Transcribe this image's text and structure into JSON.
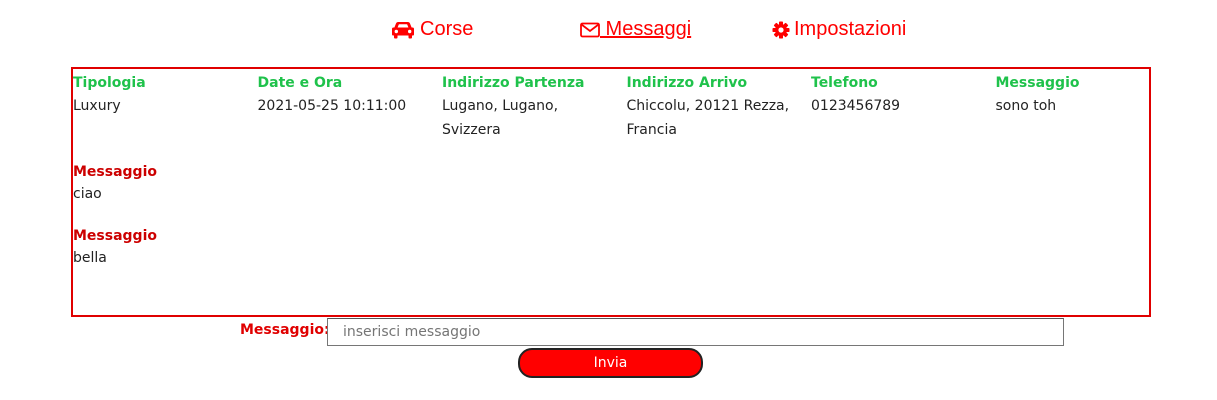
{
  "nav": {
    "items": [
      {
        "label": "Corse",
        "icon": "car-icon"
      },
      {
        "label": " Messaggi",
        "icon": "envelope-icon"
      },
      {
        "label": "Impostazioni",
        "icon": "gear-icon"
      }
    ],
    "active": "Messaggi"
  },
  "ride": {
    "columns": [
      {
        "header": "Tipologia",
        "value": "Luxury"
      },
      {
        "header": "Date e Ora",
        "value": "2021-05-25 10:11:00"
      },
      {
        "header": "Indirizzo Partenza",
        "value": "Lugano, Lugano, Svizzera"
      },
      {
        "header": "Indirizzo Arrivo",
        "value": "Chiccolu, 20121 Rezza, Francia"
      },
      {
        "header": "Telefono",
        "value": "0123456789"
      },
      {
        "header": "Messaggio",
        "value": "sono toh"
      }
    ]
  },
  "messages": [
    {
      "header": "Messaggio",
      "text": "ciao"
    },
    {
      "header": "Messaggio",
      "text": "bella"
    }
  ],
  "form": {
    "label": "Messaggio:",
    "placeholder": "inserisci messaggio",
    "value": "",
    "submit_label": "Invia"
  },
  "colors": {
    "accent": "#ff0000",
    "header_green": "#1fc24b",
    "message_header_red": "#cc0000",
    "panel_border": "#e00000"
  }
}
